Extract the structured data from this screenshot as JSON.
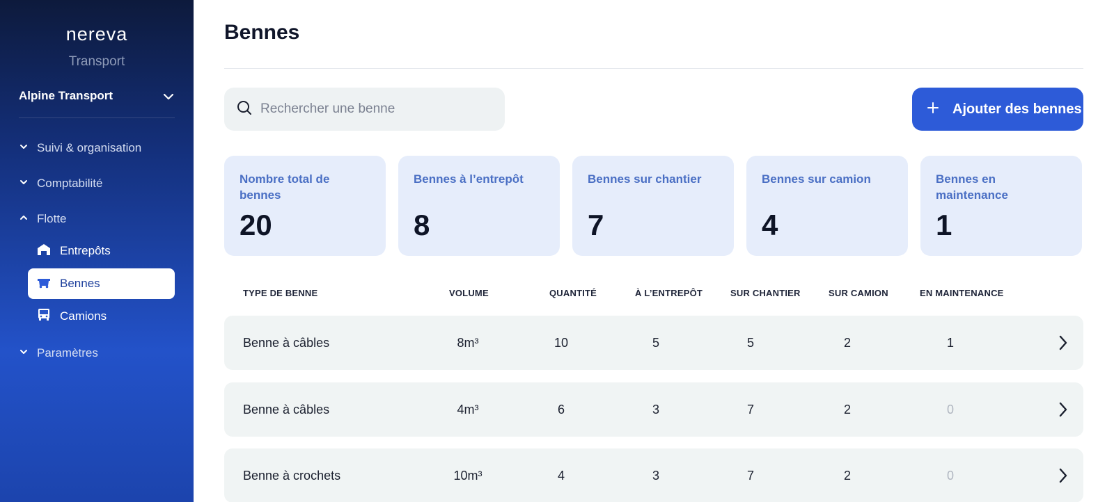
{
  "sidebar": {
    "logo": "nereva",
    "logo_sub": "Transport",
    "org_name": "Alpine Transport",
    "sections": [
      {
        "label": "Suivi & organisation",
        "expanded": false
      },
      {
        "label": "Comptabilité",
        "expanded": false
      },
      {
        "label": "Flotte",
        "expanded": true
      },
      {
        "label": "Paramètres",
        "expanded": false
      }
    ],
    "flotte_items": [
      {
        "label": "Entrepôts",
        "icon": "warehouse-icon",
        "active": false
      },
      {
        "label": "Bennes",
        "icon": "dumpster-icon",
        "active": true
      },
      {
        "label": "Camions",
        "icon": "truck-icon",
        "active": false
      }
    ]
  },
  "main": {
    "title": "Bennes",
    "search_placeholder": "Rechercher une benne",
    "add_button": "Ajouter des bennes",
    "stats": [
      {
        "label": "Nombre total de bennes",
        "value": "20"
      },
      {
        "label": "Bennes à l’entrepôt",
        "value": "8"
      },
      {
        "label": "Bennes sur chantier",
        "value": "7"
      },
      {
        "label": "Bennes sur camion",
        "value": "4"
      },
      {
        "label": "Bennes en maintenance",
        "value": "1"
      }
    ],
    "table": {
      "headers": [
        "TYPE DE BENNE",
        "VOLUME",
        "QUANTITÉ",
        "À L’ENTREPÔT",
        "SUR CHANTIER",
        "SUR CAMION",
        "EN MAINTENANCE"
      ],
      "rows": [
        {
          "type": "Benne à câbles",
          "volume": "8m³",
          "quantite": "10",
          "entrepot": "5",
          "chantier": "5",
          "camion": "2",
          "maintenance": "1"
        },
        {
          "type": "Benne à câbles",
          "volume": "4m³",
          "quantite": "6",
          "entrepot": "3",
          "chantier": "7",
          "camion": "2",
          "maintenance": "0"
        },
        {
          "type": "Benne à crochets",
          "volume": "10m³",
          "quantite": "4",
          "entrepot": "3",
          "chantier": "7",
          "camion": "2",
          "maintenance": "0"
        }
      ]
    }
  },
  "colors": {
    "accent": "#2d5bd8",
    "card_bg": "#e6edfb",
    "card_label": "#4a6fc4",
    "row_bg": "#f0f4f4"
  }
}
